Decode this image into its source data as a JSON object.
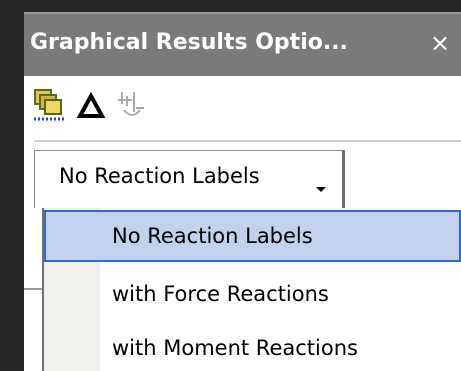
{
  "window": {
    "title": "Graphical Results Optio...",
    "close_glyph": "×"
  },
  "toolbar": {
    "icons": [
      "copy-layers-icon",
      "triangle-icon",
      "support-reaction-icon"
    ]
  },
  "combo": {
    "selected_value": "No Reaction Labels"
  },
  "menu": {
    "items": [
      {
        "label": "No Reaction Labels",
        "selected": true
      },
      {
        "label": "with Force Reactions",
        "selected": false
      },
      {
        "label": "with Moment Reactions",
        "selected": false
      }
    ]
  },
  "colors": {
    "titlebar": "#7a7a7a",
    "selection_fill": "#c1d2ee",
    "selection_border": "#316ac5",
    "menu_gutter": "#f0f0ec"
  }
}
